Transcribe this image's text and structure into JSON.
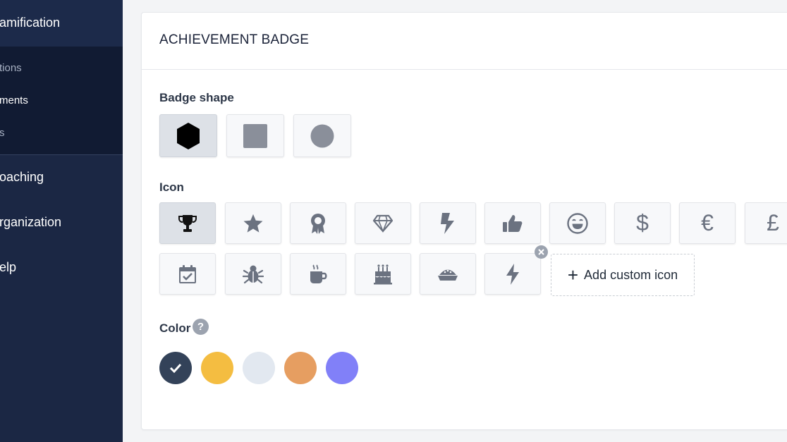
{
  "sidebar": {
    "section_title": "amification",
    "sub_items": [
      {
        "label": "tions"
      },
      {
        "label": "ments"
      },
      {
        "label": "s"
      }
    ],
    "main_items": [
      {
        "label": "oaching"
      },
      {
        "label": "rganization"
      },
      {
        "label": "elp"
      }
    ]
  },
  "card": {
    "title": "ACHIEVEMENT BADGE",
    "badge_shape": {
      "label": "Badge shape",
      "options": [
        {
          "name": "hexagon",
          "selected": true
        },
        {
          "name": "square",
          "selected": false
        },
        {
          "name": "circle",
          "selected": false
        }
      ]
    },
    "icon": {
      "label": "Icon",
      "options": [
        {
          "icon": "trophy-icon",
          "selected": true
        },
        {
          "icon": "star-icon"
        },
        {
          "icon": "award-icon"
        },
        {
          "icon": "gem-icon"
        },
        {
          "icon": "lightning-icon"
        },
        {
          "icon": "thumbs-up-icon"
        },
        {
          "icon": "laughing-face-icon"
        },
        {
          "icon": "dollar-icon",
          "glyph": "$"
        },
        {
          "icon": "euro-icon",
          "glyph": "€"
        },
        {
          "icon": "pound-icon",
          "glyph": "£"
        },
        {
          "icon": "calendar-check-icon"
        },
        {
          "icon": "bug-icon"
        },
        {
          "icon": "coffee-icon"
        },
        {
          "icon": "birthday-cake-icon"
        },
        {
          "icon": "pie-icon"
        },
        {
          "icon": "custom-lightning-icon",
          "removable": true
        }
      ],
      "add_custom_label": "Add custom icon",
      "add_custom_glyph": "+"
    },
    "color": {
      "label": "Color",
      "help_glyph": "?",
      "swatches": [
        {
          "hex": "#334259",
          "selected": true
        },
        {
          "hex": "#f4bd41"
        },
        {
          "hex": "#e2e8f0"
        },
        {
          "hex": "#e69e61"
        },
        {
          "hex": "#8180f8"
        }
      ]
    }
  },
  "colors": {
    "sidebar_bg": "#1b2744",
    "sidebar_sub_bg": "#111b33",
    "icon_gray": "#6b7280",
    "selected_tile_bg": "#dde1e7"
  }
}
